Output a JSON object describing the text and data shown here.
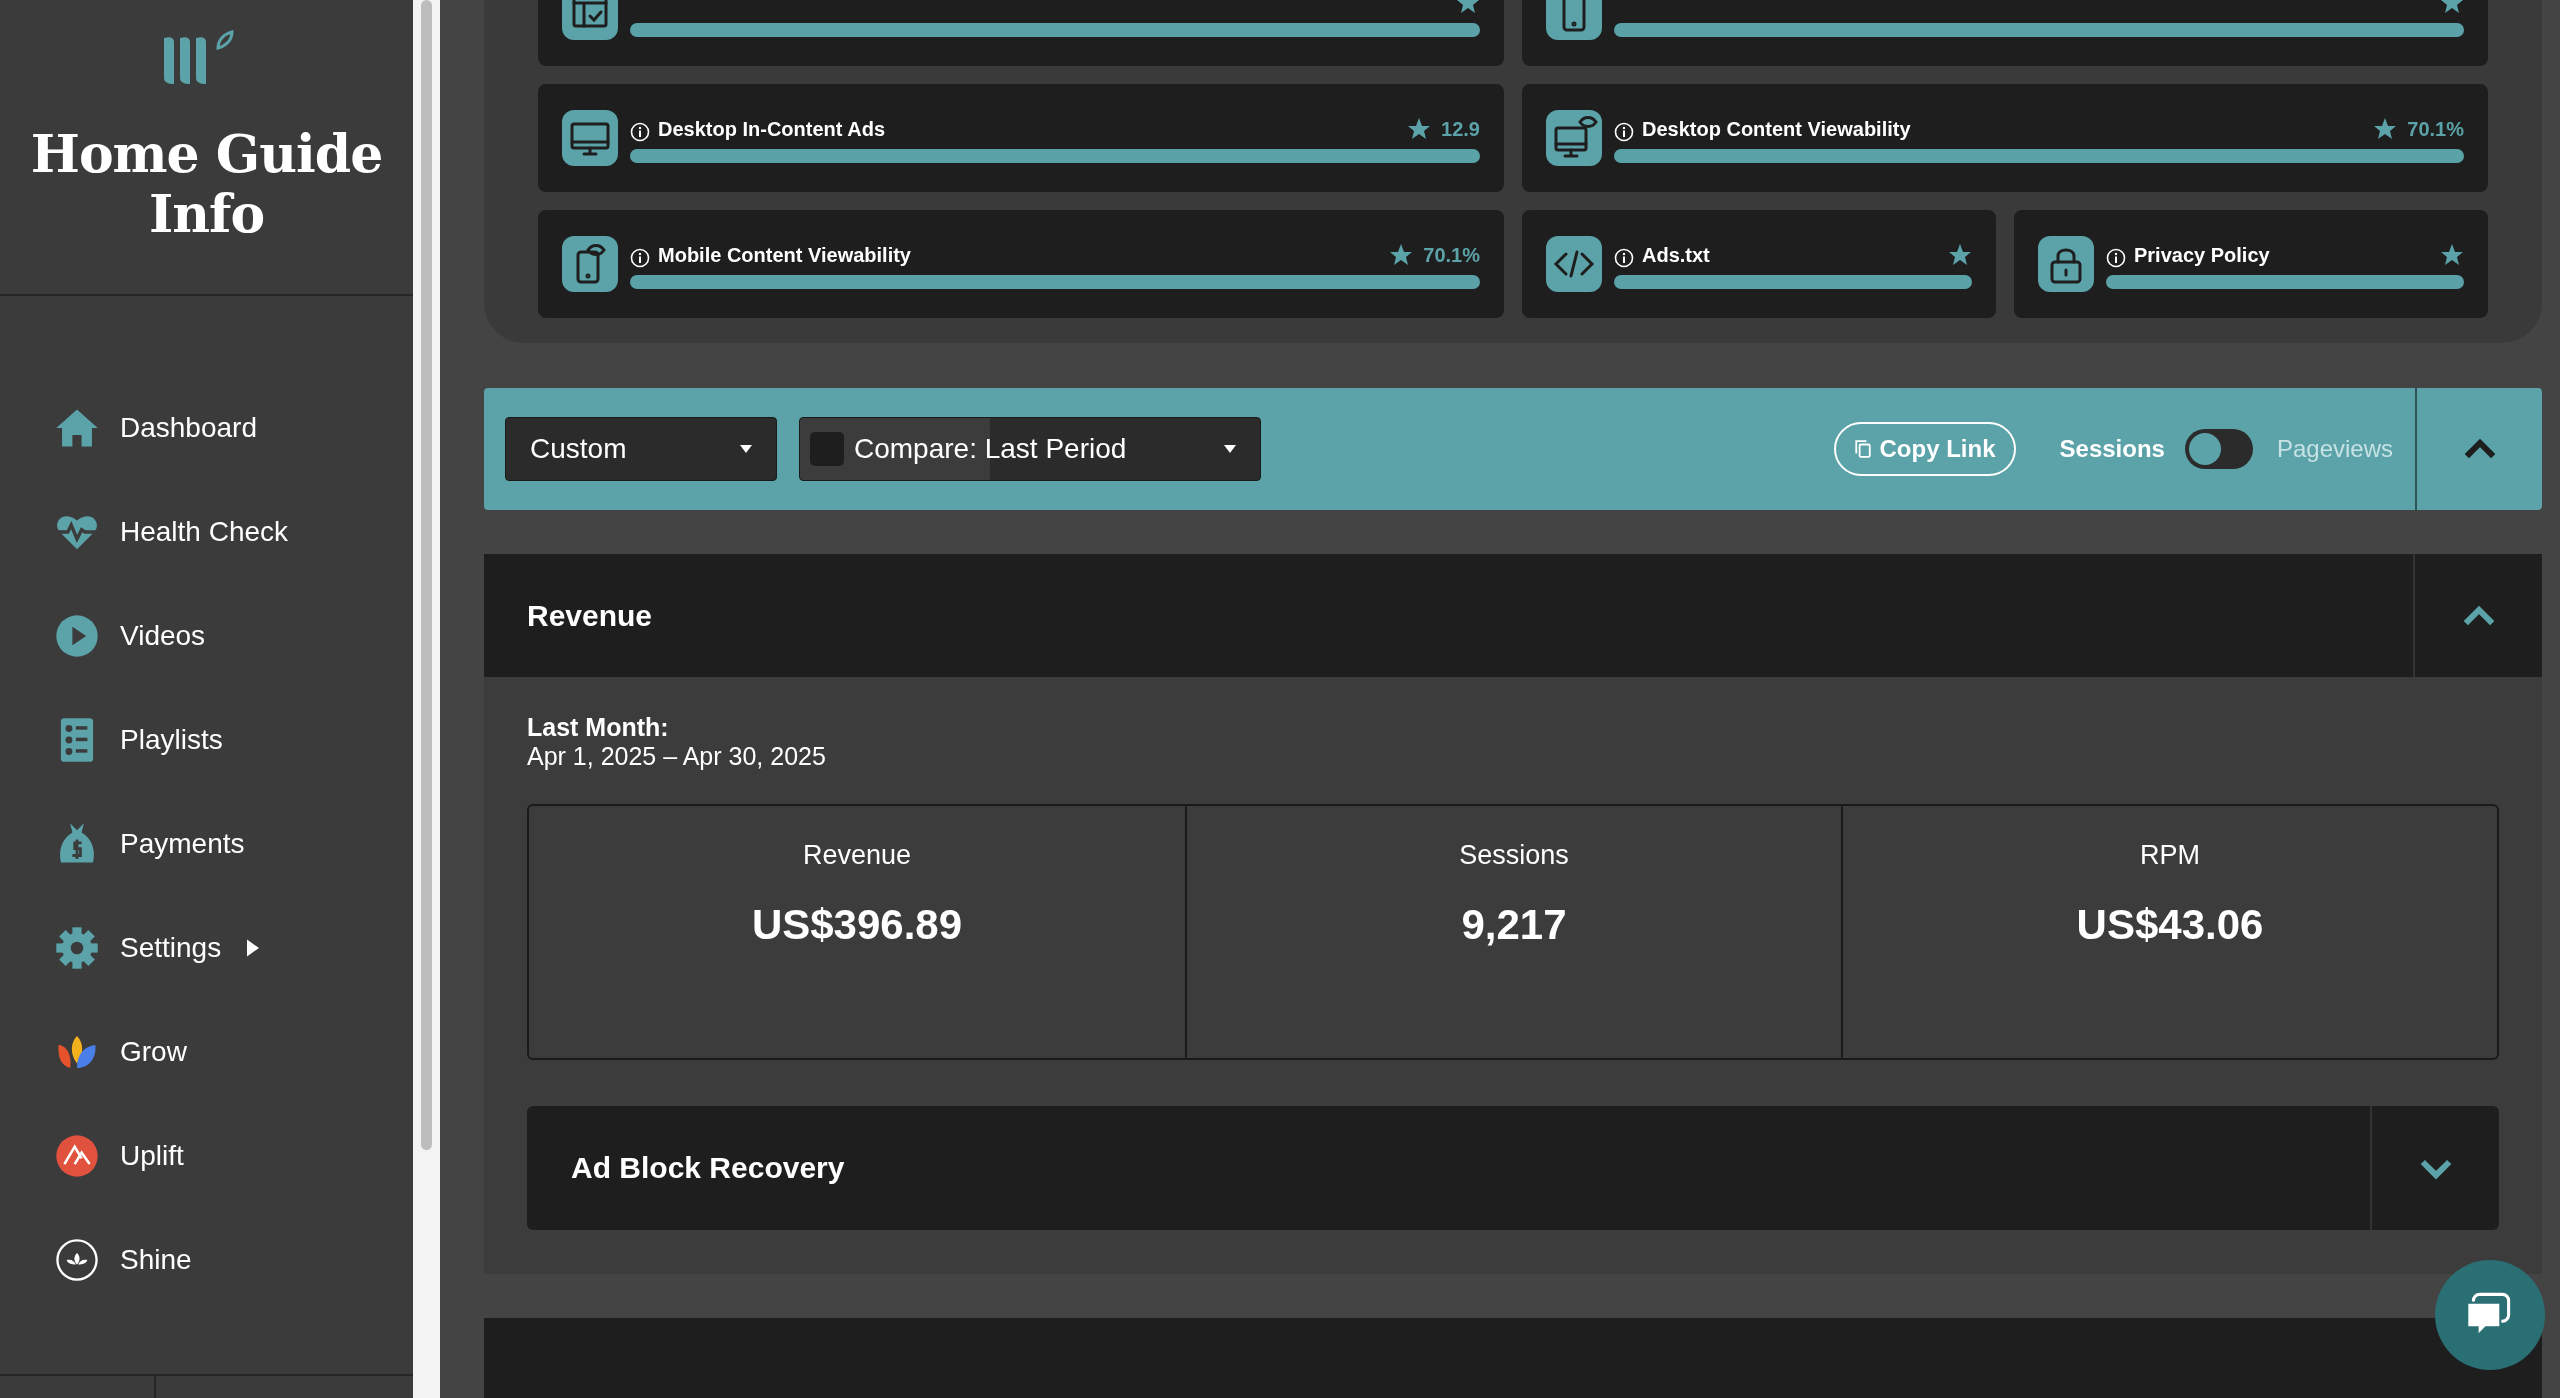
{
  "sidebar": {
    "site_title": "Home Guide Info",
    "items": [
      {
        "label": "Dashboard",
        "kind": "home",
        "submenu": false
      },
      {
        "label": "Health Check",
        "kind": "heart",
        "submenu": false
      },
      {
        "label": "Videos",
        "kind": "play",
        "submenu": false
      },
      {
        "label": "Playlists",
        "kind": "list",
        "submenu": false
      },
      {
        "label": "Payments",
        "kind": "bag",
        "submenu": false
      },
      {
        "label": "Settings",
        "kind": "gear",
        "submenu": true
      },
      {
        "label": "Grow",
        "kind": "grow",
        "submenu": false
      },
      {
        "label": "Uplift",
        "kind": "uplift",
        "submenu": false
      },
      {
        "label": "Shine",
        "kind": "shine",
        "submenu": false
      }
    ]
  },
  "health_cards": [
    {
      "kind": "sidebar",
      "wide": true
    },
    {
      "kind": "mobile",
      "wide": true
    },
    {
      "title": "Desktop In-Content Ads",
      "value": "12.9",
      "kind": "desktop",
      "wide": true
    },
    {
      "title": "Desktop Content Viewability",
      "value": "70.1%",
      "kind": "desktop-eye",
      "wide": true
    },
    {
      "title": "Mobile Content Viewability",
      "value": "70.1%",
      "kind": "mobile-eye",
      "wide": true
    },
    {
      "title": "Ads.txt",
      "kind": "code",
      "wide": false
    },
    {
      "title": "Privacy Policy",
      "kind": "lock",
      "wide": false
    }
  ],
  "toolbar": {
    "range": "Custom",
    "compare": {
      "label": "Compare: Last Period",
      "checked": false
    },
    "copy_link": "Copy Link",
    "toggle": {
      "left": "Sessions",
      "right": "Pageviews",
      "on": false
    }
  },
  "sections": [
    {
      "title": "Revenue",
      "expanded": true,
      "period_label": "Last Month:",
      "period": "Apr 1, 2025 – Apr 30, 2025",
      "stats": [
        {
          "label": "Revenue",
          "value": "US$396.89"
        },
        {
          "label": "Sessions",
          "value": "9,217"
        },
        {
          "label": "RPM",
          "value": "US$43.06"
        }
      ],
      "subsections": [
        {
          "title": "Ad Block Recovery",
          "expanded": false
        }
      ]
    }
  ]
}
